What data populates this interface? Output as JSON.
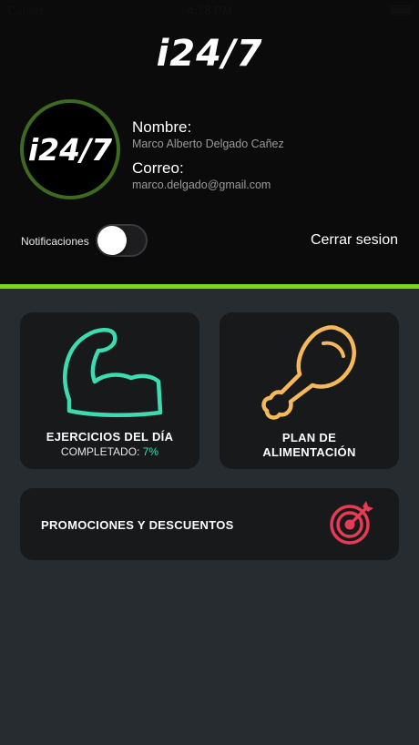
{
  "status_bar": {
    "carrier": "Carrier",
    "time": "4:38 PM"
  },
  "header": {
    "logo_text": "i24/7"
  },
  "profile": {
    "avatar_text": "i24/7",
    "name_label": "Nombre:",
    "name_value": "Marco Alberto Delgado Cañez",
    "email_label": "Correo:",
    "email_value": "marco.delgado@gmail.com"
  },
  "settings": {
    "notifications_label": "Notificaciones",
    "notifications_enabled": false,
    "logout_label": "Cerrar sesion"
  },
  "cards": {
    "exercise": {
      "title": "EJERCICIOS DEL DÍA",
      "completed_label": "COMPLETADO: ",
      "completed_value": "7%"
    },
    "food": {
      "title_line1": "PLAN DE",
      "title_line2": "ALIMENTACIÓN"
    },
    "promo": {
      "title": "PROMOCIONES Y DESCUENTOS"
    }
  },
  "colors": {
    "accent": "#7ed321",
    "exercise_icon": "#3ddbb0",
    "food_icon": "#f5b95a",
    "promo_icon": "#e83a52"
  },
  "icons": {
    "exercise": "flexed-arm-icon",
    "food": "chicken-leg-icon",
    "promo": "target-arrow-icon"
  }
}
